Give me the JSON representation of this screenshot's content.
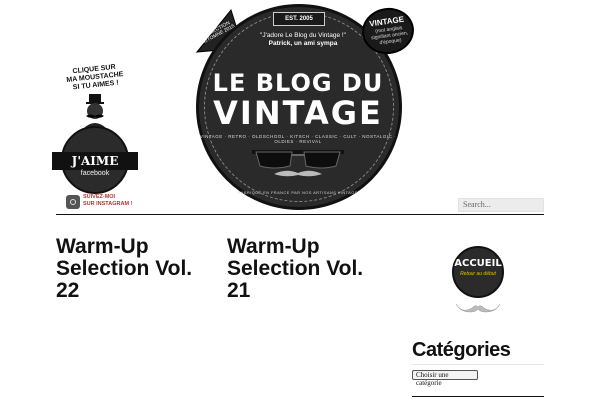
{
  "facebook_badge": {
    "cta_lines": [
      "CLIQUE SUR",
      "MA MOUSTACHE",
      "SI TU AIMES !"
    ],
    "like_label": "J'AIME",
    "platform_label": "facebook",
    "instagram_lines": [
      "SUIVEZ-MOI",
      "SUR INSTAGRAM !"
    ]
  },
  "logo": {
    "collection_lines": [
      "COLLECTION",
      "AUTOMNE 2015"
    ],
    "est_label": "EST. 2005",
    "quote_line1": "\"J'adore Le Blog du Vintage !\"",
    "quote_line2": "Patrick, un ami sympa",
    "title_line1": "LE BLOG DU",
    "title_line2": "VINTAGE",
    "tagline": "VINTAGE · RETRO · OLDSCHOOL · KITSCH · CLASSIC · CULT · NOSTALGIC · OLDIES · REVIVAL",
    "bottom_text": "FABRIQUÉ EN FRANCE PAR NOS ARTISANS VINTAGE",
    "vintage_badge_title": "VINTAGE",
    "vintage_badge_sub": "(mot anglais signifiant ancien, d'époque)"
  },
  "search": {
    "placeholder": "Search..."
  },
  "posts": [
    {
      "title": "Warm-Up Selection Vol. 22"
    },
    {
      "title": "Warm-Up Selection Vol. 21"
    }
  ],
  "accueil_badge": {
    "label": "ACCUEIL",
    "sub": "Retour au début"
  },
  "categories": {
    "title": "Catégories",
    "select_value": "Choisir une catégorie"
  },
  "colors": {
    "accent": "#111111",
    "badge_dark": "#2b2b2b",
    "search_bg": "#ececec"
  }
}
